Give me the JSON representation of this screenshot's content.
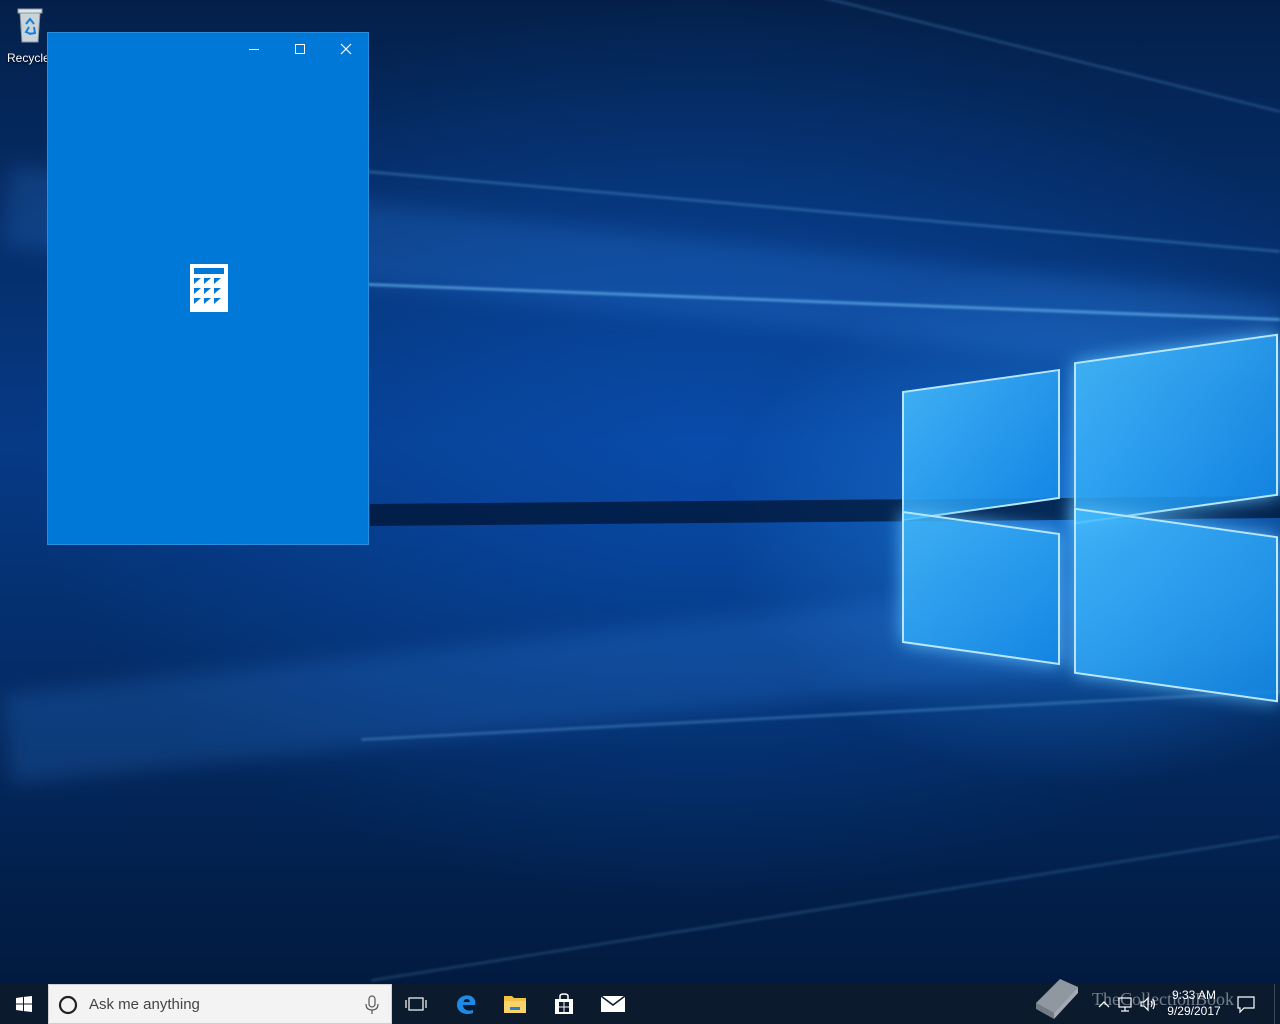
{
  "desktop": {
    "recycle_bin_label": "Recycle"
  },
  "calculator_window": {
    "app_icon": "calculator-icon",
    "accent": "#0078d7",
    "controls": {
      "minimize_icon": "minimize-icon",
      "maximize_icon": "maximize-icon",
      "close_icon": "close-icon"
    }
  },
  "taskbar": {
    "search_placeholder": "Ask me anything",
    "pinned": [
      "task-view-icon",
      "edge-icon",
      "file-explorer-icon",
      "store-icon",
      "mail-icon"
    ]
  },
  "watermark_text": "TheCollectionBook",
  "tray": {
    "time": "9:33 AM",
    "date": "9/29/2017"
  }
}
